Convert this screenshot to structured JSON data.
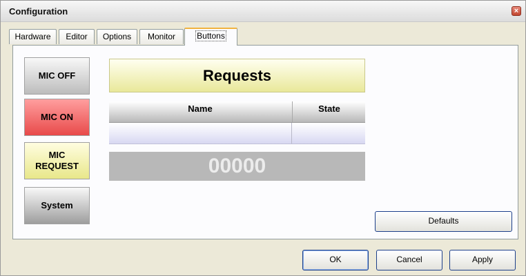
{
  "window": {
    "title": "Configuration",
    "close_glyph": "×"
  },
  "tabs": [
    {
      "label": "Hardware"
    },
    {
      "label": "Editor"
    },
    {
      "label": "Options"
    },
    {
      "label": "Monitor"
    },
    {
      "label": "Buttons",
      "active": true
    }
  ],
  "buttons_panel": {
    "side_buttons": {
      "mic_off": "MIC OFF",
      "mic_on": "MIC ON",
      "mic_request_line1": "MIC",
      "mic_request_line2": "REQUEST",
      "system": "System"
    },
    "requests_title": "Requests",
    "table": {
      "columns": [
        "Name",
        "State"
      ],
      "rows": [
        [
          "",
          ""
        ]
      ]
    },
    "counter": "00000",
    "defaults_label": "Defaults"
  },
  "footer": {
    "ok": "OK",
    "cancel": "Cancel",
    "apply": "Apply"
  },
  "colors": {
    "mic_on": "#e84a4a",
    "mic_request": "#e8e78a",
    "requests_banner": "#e9e89a",
    "active_tab_accent": "#f1b33f"
  }
}
